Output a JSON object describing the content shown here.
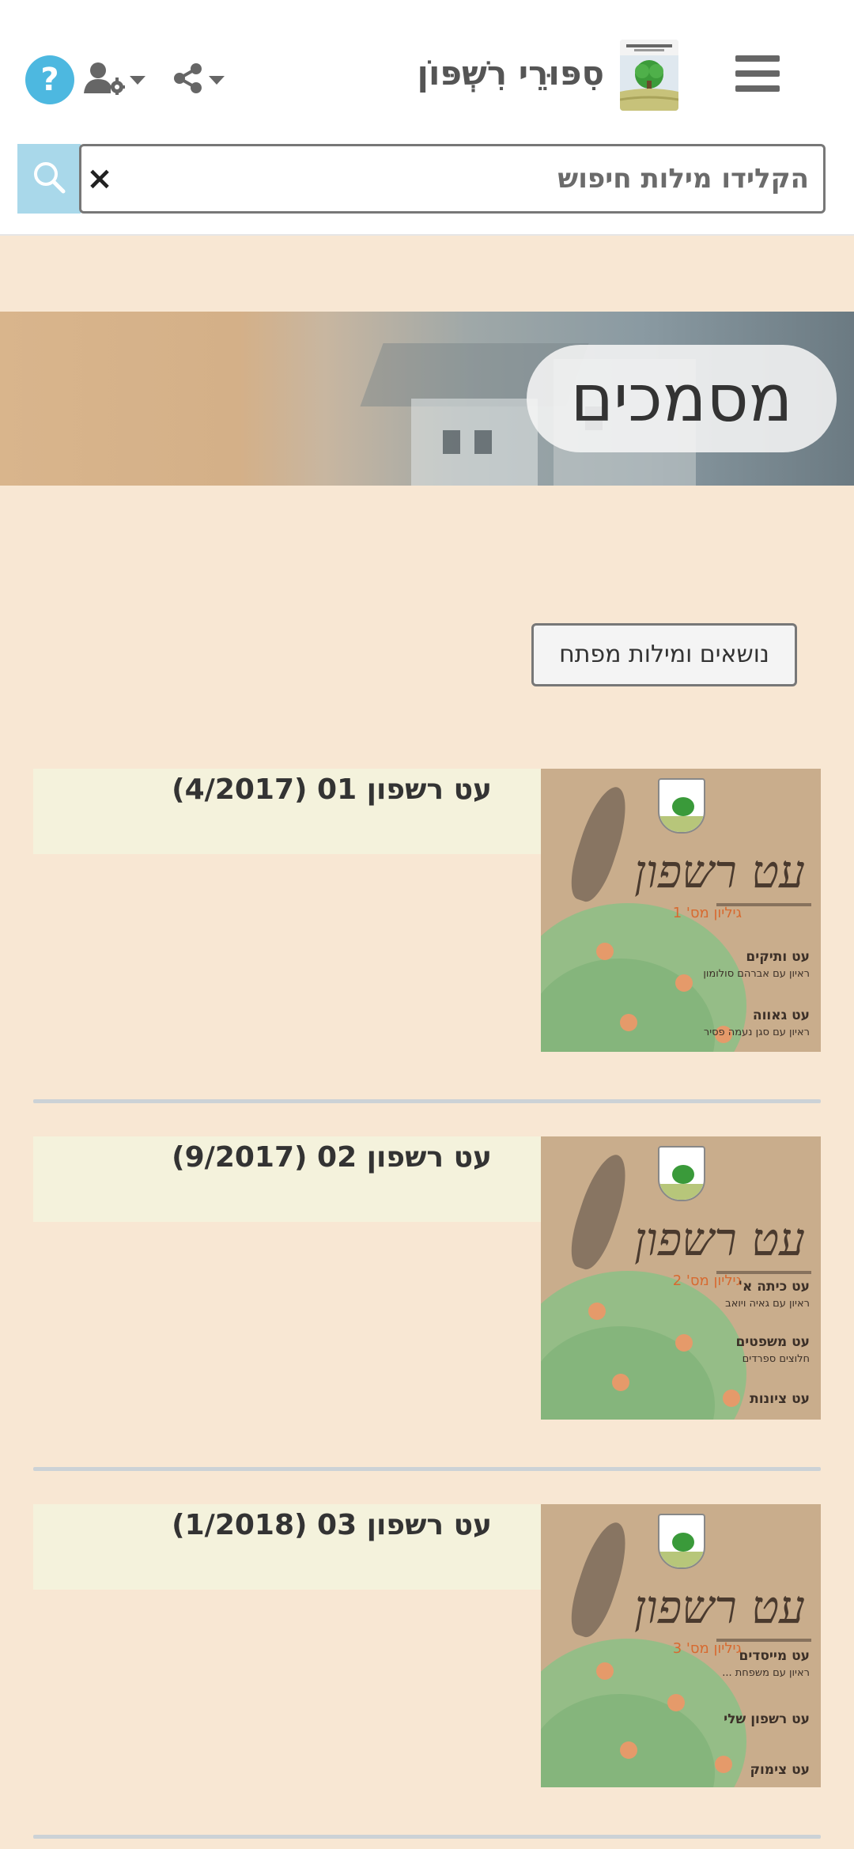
{
  "header": {
    "site_title": "סִפּוּרֵי רִשְׁפּוֹן",
    "logo_caption": "מושב רשפון",
    "help_label": "?"
  },
  "search": {
    "placeholder": "הקלידו מילות חיפוש",
    "clear_label": "×"
  },
  "banner": {
    "title": "מסמכים"
  },
  "keywords_button": "נושאים ומילות מפתח",
  "colors": {
    "page_bg": "#f8e7d3",
    "title_box_bg": "#f4f2dc",
    "help_blue": "#4db8e0",
    "search_button_bg": "#a9d8ea"
  },
  "items": [
    {
      "title": "עט רשפון 01 (4/2017)",
      "cover": {
        "crest": "מושב רשפון",
        "script": "עט רשפון",
        "subtitle": "גיליון מס' 1",
        "sections": [
          {
            "heading": "עט ותיקים",
            "text": "ראיון עם אברהם סולומון"
          },
          {
            "heading": "עט גאווה",
            "text": "ראיון עם סגן נעמה פסיר"
          }
        ]
      }
    },
    {
      "title": "עט רשפון 02 (9/2017)",
      "cover": {
        "crest": "מושב רשפון",
        "script": "עט רשפון",
        "subtitle": "גיליון מס' 2",
        "sections": [
          {
            "heading": "עט כיתה א'",
            "text": "ראיון עם גאיה ויואב"
          },
          {
            "heading": "עט משפטים",
            "text": "חלוצים ספרדים"
          },
          {
            "heading": "עט ציונות",
            "text": ""
          }
        ]
      }
    },
    {
      "title": "עט רשפון 03 (1/2018)",
      "cover": {
        "crest": "מושב רשפון",
        "script": "עט רשפון",
        "subtitle": "גיליון מס' 3",
        "sections": [
          {
            "heading": "עט מייסדים",
            "text": "ראיון עם משפחת ..."
          },
          {
            "heading": "עט רשפון שלי",
            "text": ""
          },
          {
            "heading": "עט צימוק",
            "text": ""
          }
        ]
      }
    }
  ]
}
